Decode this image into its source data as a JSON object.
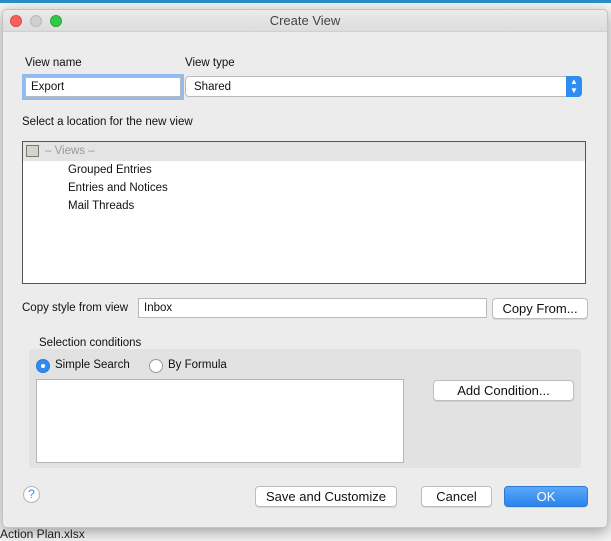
{
  "background": {
    "file_label": "Action Plan.xlsx"
  },
  "window": {
    "title": "Create View"
  },
  "form": {
    "view_name_label": "View name",
    "view_name_value": "Export",
    "view_type_label": "View type",
    "view_type_value": "Shared",
    "location_label": "Select a location for the new view",
    "location_root": "– Views –",
    "locations": [
      "Grouped Entries",
      "Entries and Notices",
      "Mail Threads"
    ],
    "copy_style_label": "Copy style from view",
    "copy_style_value": "Inbox",
    "copy_from_button": "Copy From...",
    "selection_label": "Selection conditions",
    "radio_simple": "Simple Search",
    "radio_formula": "By Formula",
    "selected_radio": "Simple Search",
    "add_condition_button": "Add Condition..."
  },
  "footer": {
    "help": "?",
    "save_customize": "Save and Customize",
    "cancel": "Cancel",
    "ok": "OK"
  },
  "colors": {
    "accent": "#2f8cf0",
    "close": "#fc605c",
    "zoom": "#34c84a"
  }
}
